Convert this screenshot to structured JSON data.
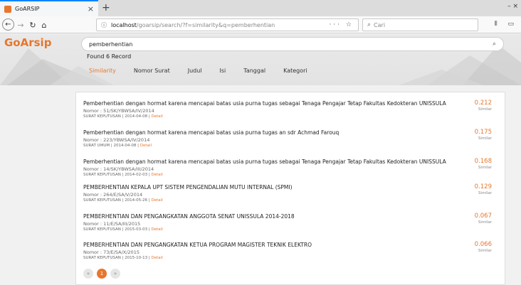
{
  "browser": {
    "tab_title": "GoARSIP",
    "tab_close": "×",
    "new_tab": "+",
    "window_controls": "– ×",
    "url_host": "localhost",
    "url_rest": "/goarsip/search/?f=similarity&q=pemberhentian",
    "url_actions": "··· ☆",
    "search_placeholder": "Cari"
  },
  "app": {
    "logo": "GoArsip",
    "search_value": "pemberhentian",
    "found_text": "Found 6 Record",
    "tabs": [
      "Similarity",
      "Nomor Surat",
      "Judul",
      "Isi",
      "Tanggal",
      "Kategori"
    ],
    "accent": "#e8762c"
  },
  "results": [
    {
      "title": "Pemberhentian dengan hormat karena mencapai batas usia purna tugas sebagai Tenaga Pengajar Tetap Fakultas Kedokteran UNISSULA",
      "nomor": "Nomor : 51/SK/YBWSA/IV/2014",
      "meta": "SURAT KEPUTUSAN | 2014-04-08 |",
      "detail": "Detail",
      "score": "0.212",
      "sim_label": "Similar"
    },
    {
      "title": "Pemberhentian dengan hormat karena mencapai batas usia purna tugas an sdr Achmad Farouq",
      "nomor": "Nomor : 223/YBWSA/IV/2014",
      "meta": "SURAT UMUM | 2014-04-08 |",
      "detail": "Detail",
      "score": "0.175",
      "sim_label": "Similar"
    },
    {
      "title": "Pemberhentian dengan hormat karena mencapai batas usia purna tugas sebagai Tenaga Pengajar Tetap Fakultas Kedokteran UNISSULA",
      "nomor": "Nomor : 14/SK/YBWSA/III/2014",
      "meta": "SURAT KEPUTUSAN | 2014-02-03 |",
      "detail": "Detail",
      "score": "0.168",
      "sim_label": "Similar"
    },
    {
      "title": "PEMBERHENTIAN KEPALA UPT SISTEM PENGENDALIAN MUTU INTERNAL (SPMI)",
      "nomor": "Nomor : 264/E/SA/V/2014",
      "meta": "SURAT KEPUTUSAN | 2014-05-26 |",
      "detail": "Detail",
      "score": "0.129",
      "sim_label": "Similar"
    },
    {
      "title": "PEMBERHENTIAN DAN PENGANGKATAN ANGGOTA SENAT UNISSULA 2014-2018",
      "nomor": "Nomor : 11/E/SA/III/2015",
      "meta": "SURAT KEPUTUSAN | 2015-03-03 |",
      "detail": "Detail",
      "score": "0.067",
      "sim_label": "Similar"
    },
    {
      "title": "PEMBERHENTIAN DAN PENGANGKATAN KETUA PROGRAM MAGISTER TEKNIK ELEKTRO",
      "nomor": "Nomor : 73/E/SA/X/2015",
      "meta": "SURAT KEPUTUSAN | 2015-10-13 |",
      "detail": "Detail",
      "score": "0.066",
      "sim_label": "Similar"
    }
  ],
  "pagination": {
    "prev": "«",
    "current": "1",
    "next": "»"
  }
}
